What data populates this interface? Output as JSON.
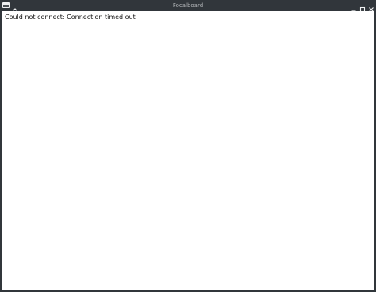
{
  "window": {
    "title": "Focalboard"
  },
  "titlebar_buttons": {
    "app_menu_icon": "app-menu-icon",
    "keep_above_icon": "chevron-up-icon",
    "minimize_icon": "minimize-icon",
    "maximize_icon": "maximize-icon",
    "close_icon": "close-icon"
  },
  "content": {
    "error_message": "Could not connect: Connection timed out"
  },
  "colors": {
    "titlebar_bg": "#31363b",
    "title_text": "#b3b6b9",
    "content_bg": "#ffffff",
    "message_text": "#111111"
  }
}
